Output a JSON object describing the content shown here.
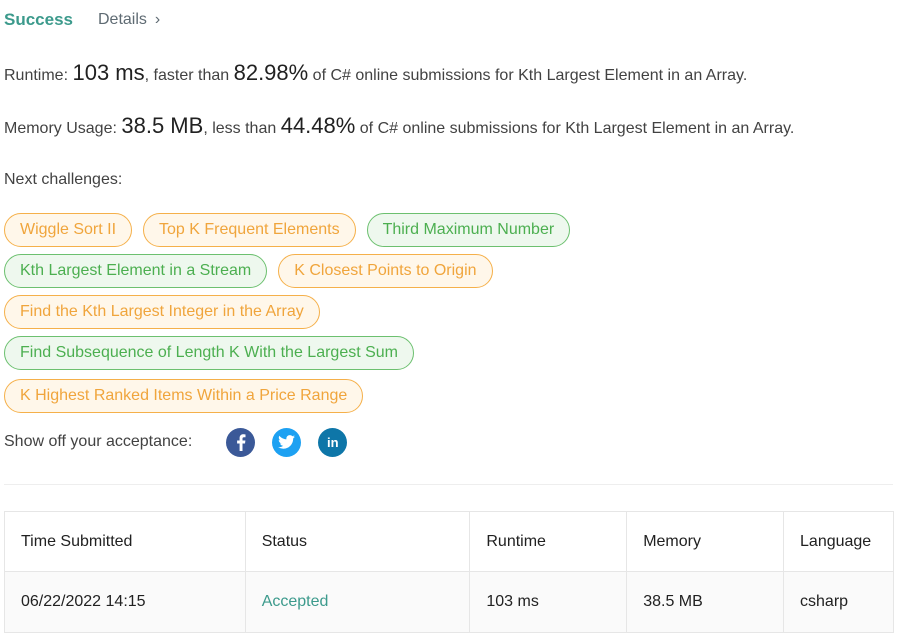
{
  "header": {
    "title": "Success",
    "details_label": "Details",
    "details_chevron": "›"
  },
  "runtime": {
    "label": "Runtime:",
    "value": "103 ms",
    "mid": ", faster than",
    "percent": "82.98%",
    "suffix": "of C# online submissions for Kth Largest Element in an Array."
  },
  "memory": {
    "label": "Memory Usage:",
    "value": "38.5 MB",
    "mid": ", less than",
    "percent": "44.48%",
    "suffix": "of C# online submissions for Kth Largest Element in an Array."
  },
  "next": {
    "label": "Next challenges:",
    "challenges": [
      {
        "label": "Wiggle Sort II",
        "difficulty": "medium"
      },
      {
        "label": "Top K Frequent Elements",
        "difficulty": "medium"
      },
      {
        "label": "Third Maximum Number",
        "difficulty": "easy"
      },
      {
        "label": "Kth Largest Element in a Stream",
        "difficulty": "easy"
      },
      {
        "label": "K Closest Points to Origin",
        "difficulty": "medium"
      },
      {
        "label": "Find the Kth Largest Integer in the Array",
        "difficulty": "medium"
      },
      {
        "label": "Find Subsequence of Length K With the Largest Sum",
        "difficulty": "easy"
      },
      {
        "label": "K Highest Ranked Items Within a Price Range",
        "difficulty": "medium"
      }
    ]
  },
  "share": {
    "label": "Show off your acceptance:",
    "icons": [
      "facebook-icon",
      "twitter-icon",
      "linkedin-icon"
    ],
    "glyphs": {
      "facebook": "f",
      "twitter": "🐦",
      "linkedin": "in"
    }
  },
  "colors": {
    "success": "#3c9a8c",
    "medium_border": "#f5b04a",
    "easy_border": "#6cc06f",
    "facebook": "#3b5998",
    "twitter": "#1da1f2",
    "linkedin": "#0e76a8"
  },
  "table": {
    "headers": [
      "Time Submitted",
      "Status",
      "Runtime",
      "Memory",
      "Language"
    ],
    "rows": [
      [
        "06/22/2022 14:15",
        "Accepted",
        "103 ms",
        "38.5 MB",
        "csharp"
      ]
    ]
  }
}
